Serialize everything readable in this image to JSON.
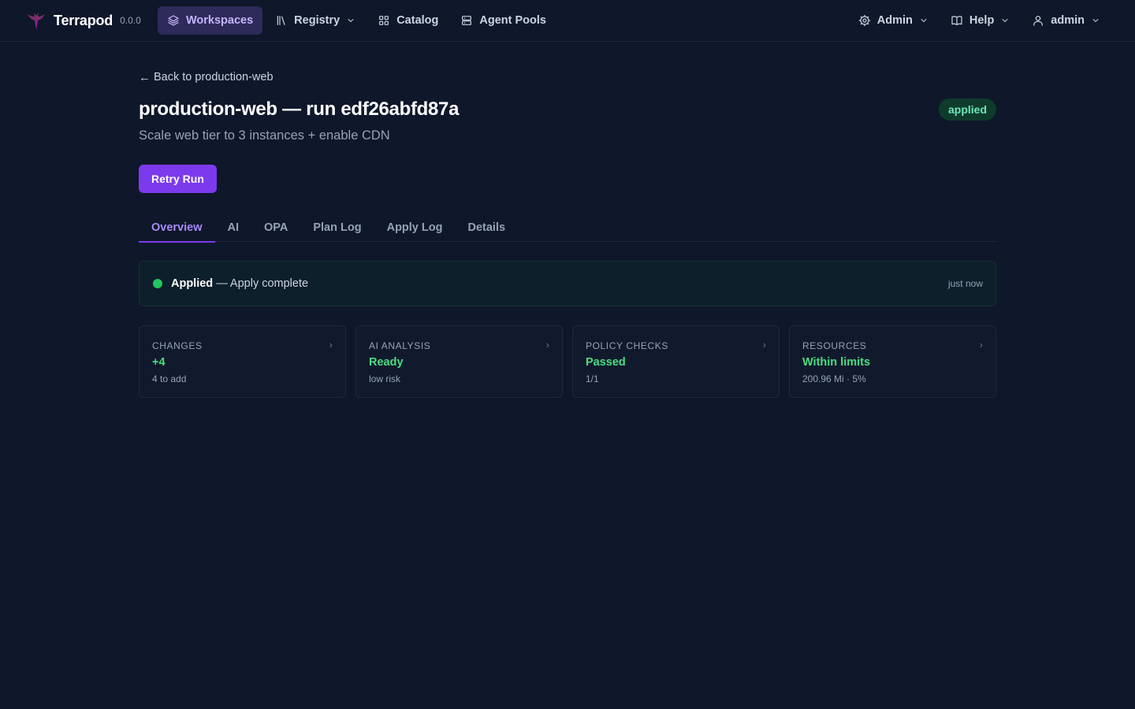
{
  "brand": {
    "name": "Terrapod",
    "version": "0.0.0"
  },
  "nav": {
    "items": [
      {
        "label": "Workspaces",
        "icon": "layers-icon",
        "active": true
      },
      {
        "label": "Registry",
        "icon": "library-icon",
        "dropdown": true
      },
      {
        "label": "Catalog",
        "icon": "grid-icon"
      },
      {
        "label": "Agent Pools",
        "icon": "server-icon"
      }
    ],
    "right": [
      {
        "label": "Admin",
        "icon": "gear-icon",
        "dropdown": true
      },
      {
        "label": "Help",
        "icon": "book-icon",
        "dropdown": true
      },
      {
        "label": "admin",
        "icon": "user-icon",
        "dropdown": true
      }
    ]
  },
  "page": {
    "back_arrow": "←",
    "back_label": "Back to production-web",
    "title": "production-web — run edf26abfd87a",
    "status_pill": "applied",
    "subtitle": "Scale web tier to 3 instances + enable CDN",
    "retry_label": "Retry Run"
  },
  "tabs": [
    "Overview",
    "AI",
    "OPA",
    "Plan Log",
    "Apply Log",
    "Details"
  ],
  "active_tab": "Overview",
  "banner": {
    "status": "Applied",
    "message": " — Apply complete",
    "time": "just now"
  },
  "cards": [
    {
      "label": "Changes",
      "value": "+4",
      "sub": "4 to add"
    },
    {
      "label": "AI Analysis",
      "value": "Ready",
      "sub": "low risk"
    },
    {
      "label": "Policy Checks",
      "value": "Passed",
      "sub": "1/1"
    },
    {
      "label": "Resources",
      "value": "Within limits",
      "sub": "200.96 Mi · 5%"
    }
  ],
  "chevron": "›",
  "colors": {
    "background": "#0f172a",
    "accent": "#7c3aed",
    "success": "#4ade80",
    "status_dot": "#22c55e"
  }
}
